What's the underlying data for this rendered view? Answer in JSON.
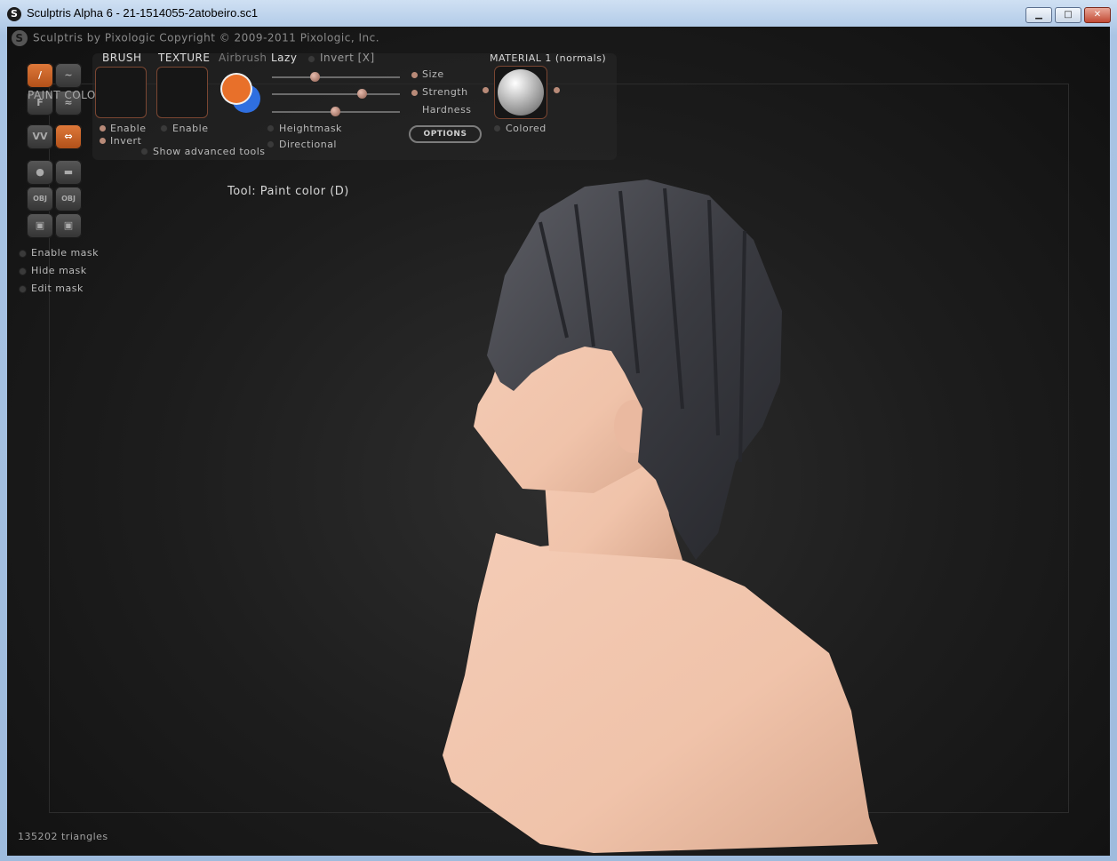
{
  "window": {
    "title": "Sculptris Alpha 6 - 21-1514055-2atobeiro.sc1",
    "minimize_label": "▁",
    "maximize_label": "□",
    "close_label": "✕"
  },
  "header": {
    "logo_glyph": "S",
    "copyright": "Sculptris by Pixologic    Copyright © 2009-2011 Pixologic, Inc."
  },
  "tools": {
    "paint_color_label": "PAINT COLOR [D]",
    "buttons": [
      {
        "name": "paint-color",
        "glyph": "/"
      },
      {
        "name": "paint-bump",
        "glyph": "~"
      },
      {
        "name": "flatten",
        "glyph": "F"
      },
      {
        "name": "smooth",
        "glyph": "≈"
      },
      {
        "name": "zigzag",
        "glyph": "VV"
      },
      {
        "name": "symmetry",
        "glyph": "⇔"
      },
      {
        "name": "sphere",
        "glyph": "●"
      },
      {
        "name": "plane",
        "glyph": "▬"
      },
      {
        "name": "import-obj",
        "glyph": "OBJ"
      },
      {
        "name": "export-obj",
        "glyph": "OBJ"
      },
      {
        "name": "save",
        "glyph": "▣"
      },
      {
        "name": "save-as",
        "glyph": "▣"
      }
    ],
    "mask_options": [
      "Enable mask",
      "Hide mask",
      "Edit mask"
    ]
  },
  "brush": {
    "brush_label": "BRUSH",
    "texture_label": "TEXTURE",
    "airbrush_label": "Airbrush",
    "lazy_label": "Lazy",
    "invert_label": "Invert [X]",
    "brush_enable": "Enable",
    "brush_invert": "Invert",
    "texture_enable": "Enable",
    "show_advanced": "Show advanced tools",
    "heightmask": "Heightmask",
    "directional": "Directional",
    "size_label": "Size",
    "strength_label": "Strength",
    "hardness_label": "Hardness",
    "options_label": "OPTIONS",
    "primary_color": "#e8702a",
    "secondary_color": "#2f6fe0"
  },
  "material": {
    "label": "MATERIAL 1 (normals)",
    "colored_label": "Colored"
  },
  "status": {
    "tool_caption": "Tool: Paint color (D)",
    "triangles": "135202 triangles"
  }
}
